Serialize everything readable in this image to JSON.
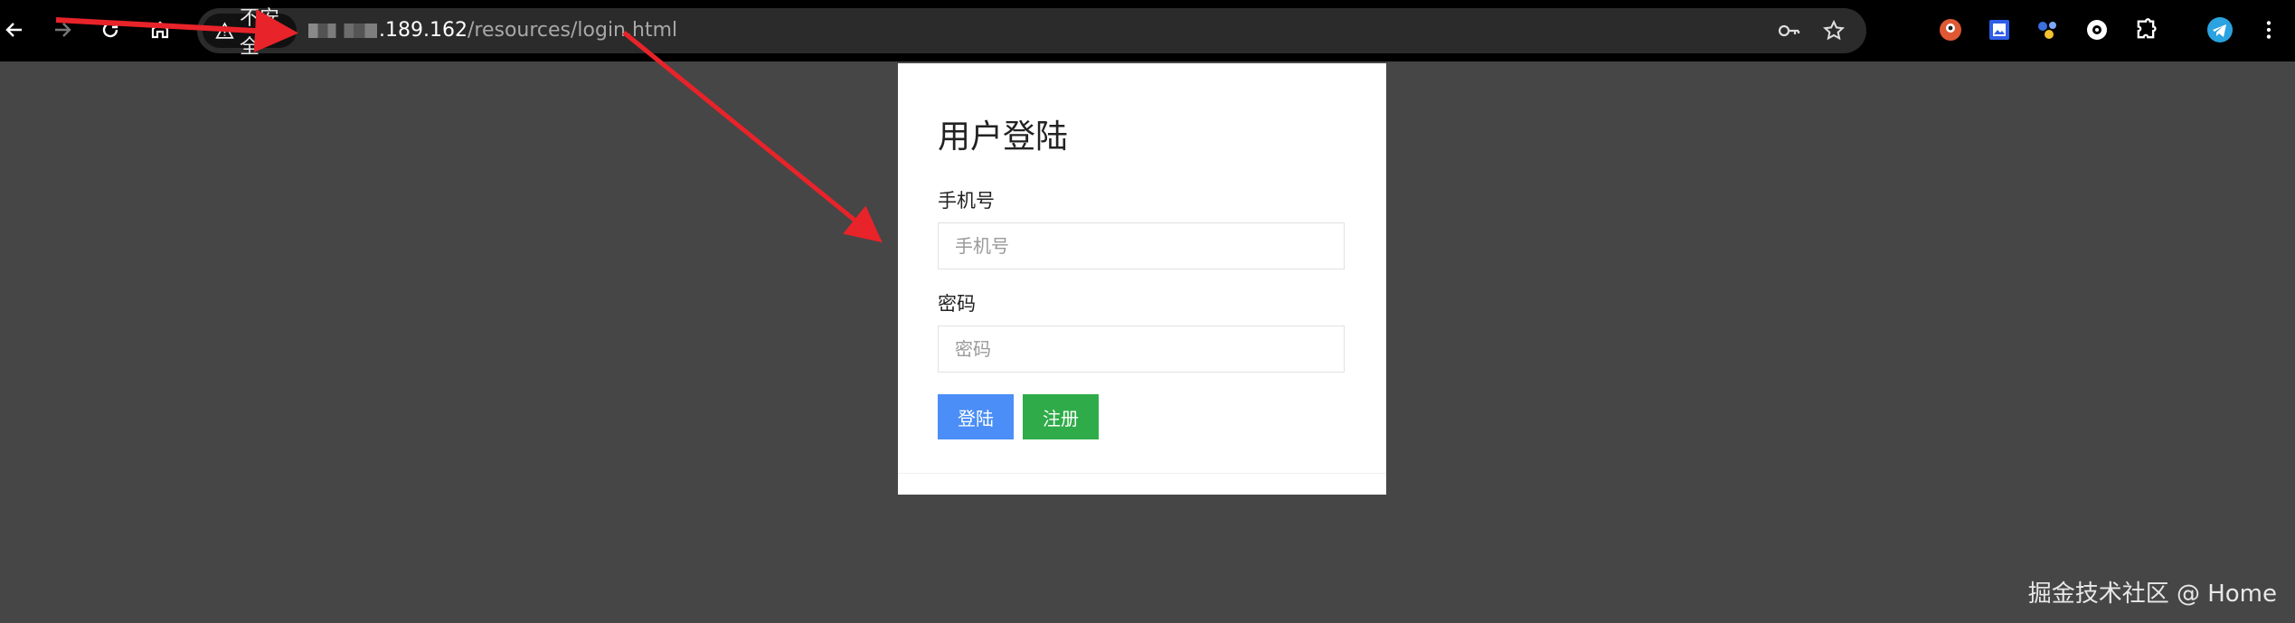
{
  "browser": {
    "security_chip_label": "不安全",
    "url": {
      "host_suffix": ".189.162",
      "path": "/resources/login.html"
    },
    "icons": [
      "back-icon",
      "forward-icon",
      "reload-icon",
      "home-icon",
      "key-icon",
      "star-icon",
      "extension-icons",
      "puzzle-icon",
      "telegram-icon",
      "menu-icon"
    ]
  },
  "login": {
    "title": "用户登陆",
    "phone_label": "手机号",
    "phone_placeholder": "手机号",
    "password_label": "密码",
    "password_placeholder": "密码",
    "login_button": "登陆",
    "register_button": "注册"
  },
  "watermark": "掘金技术社区 @ Home",
  "colors": {
    "background": "#464646",
    "login_button": "#4b8ef7",
    "register_button": "#2fac49",
    "annotation_arrow": "#e8232a"
  }
}
